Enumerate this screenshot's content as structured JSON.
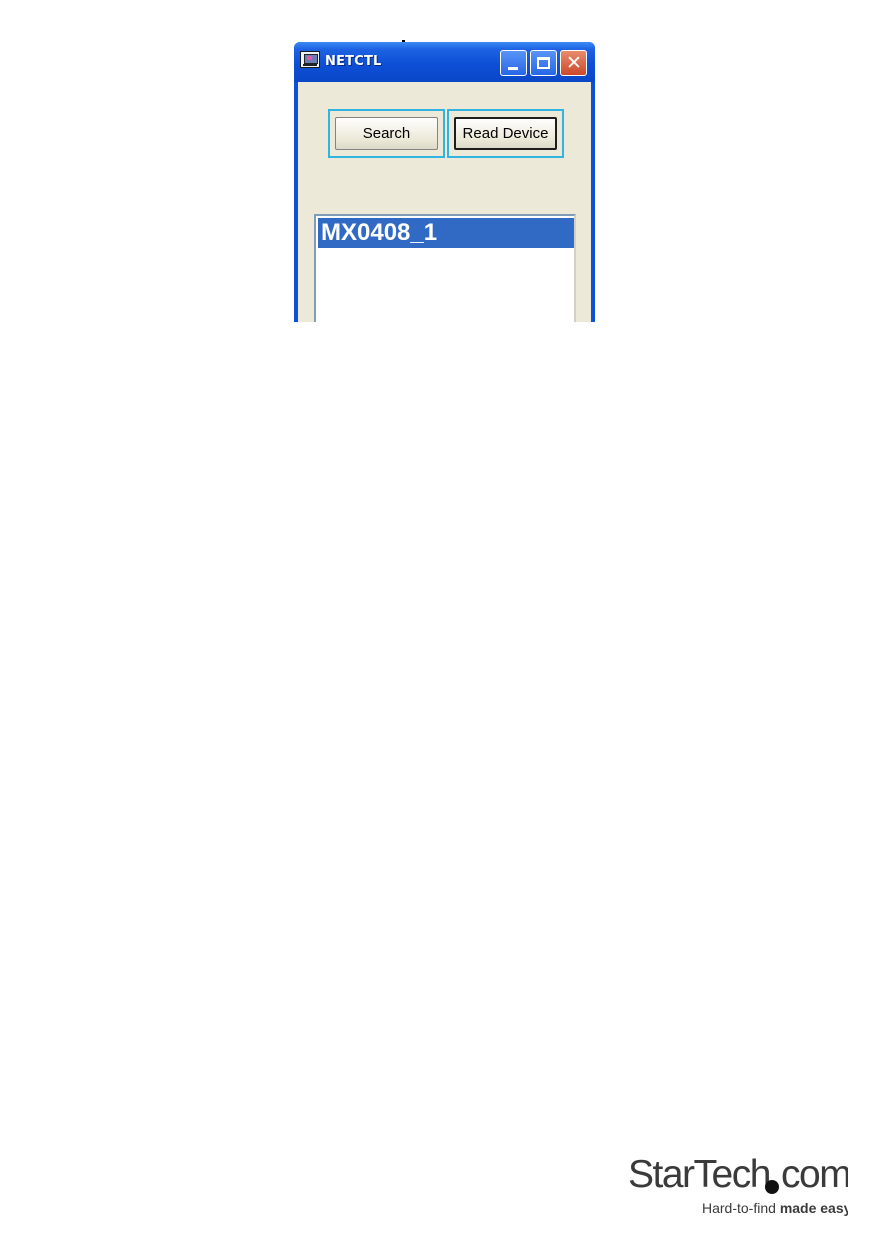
{
  "window": {
    "title": "NETCTL",
    "icon": "netctl-app-icon",
    "controls": {
      "minimize_icon": "minimize-icon",
      "maximize_icon": "maximize-icon",
      "close_icon": "close-icon",
      "close_glyph": "✕"
    }
  },
  "buttons": {
    "search_label": "Search",
    "read_device_label": "Read Device"
  },
  "device_list": {
    "items": [
      {
        "label": "MX0408_1",
        "selected": true
      }
    ]
  },
  "footer": {
    "brand_name": "StarTech.com",
    "tagline_regular": "Hard-to-find ",
    "tagline_bold": "made easy",
    "registered_mark": "®"
  },
  "colors": {
    "title_bar": "#0a52d8",
    "highlight_frame": "#33b3e0",
    "selection": "#316ac5",
    "client_background": "#ece9d8"
  }
}
